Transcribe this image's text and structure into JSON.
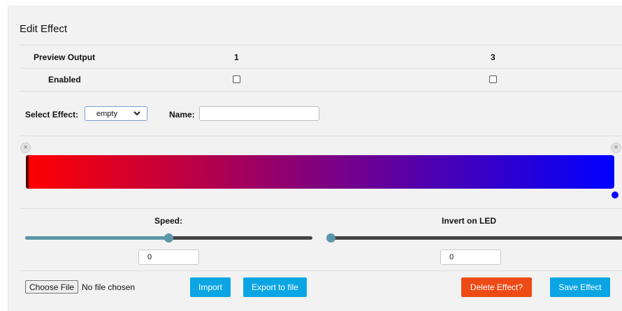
{
  "editor": {
    "title": "Edit Effect",
    "preview_label": "Preview Output",
    "outputs": [
      "1",
      "3"
    ],
    "enabled_label": "Enabled",
    "enabled": [
      false,
      false
    ],
    "select_effect_label": "Select Effect:",
    "select_effect_value": "empty",
    "name_label": "Name:",
    "name_value": "",
    "gradient_colors": [
      "#ff0000",
      "#0000ff"
    ],
    "speed_label": "Speed:",
    "speed_value": "0",
    "invert_label": "Invert on LED",
    "invert_value": "0",
    "choose_file_label": "Choose File",
    "no_file_label": "No file chosen",
    "import_label": "Import",
    "export_label": "Export to file",
    "delete_label": "Delete Effect?",
    "save_label": "Save Effect",
    "accent_color": "#0ba5e4",
    "danger_color": "#ee4a16",
    "slider_color": "#5b97a8"
  }
}
